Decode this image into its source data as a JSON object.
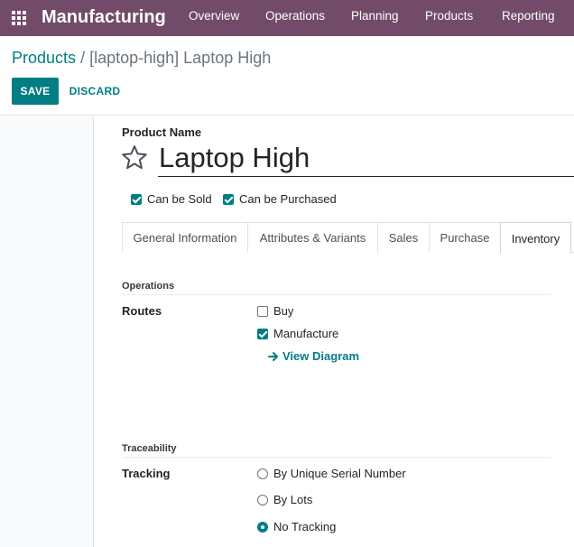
{
  "navbar": {
    "brand": "Manufacturing",
    "menu": [
      "Overview",
      "Operations",
      "Planning",
      "Products",
      "Reporting"
    ],
    "background": "#714B67"
  },
  "breadcrumb": {
    "parent": "Products",
    "separator": "/",
    "current": "[laptop-high] Laptop High"
  },
  "buttons": {
    "save": "SAVE",
    "discard": "DISCARD"
  },
  "form": {
    "product_name_label": "Product Name",
    "product_name": "Laptop High",
    "favorite_icon": "star-outline-icon",
    "can_be_sold": {
      "label": "Can be Sold",
      "checked": true
    },
    "can_be_purchased": {
      "label": "Can be Purchased",
      "checked": true
    }
  },
  "tabs": [
    {
      "label": "General Information",
      "active": false
    },
    {
      "label": "Attributes & Variants",
      "active": false
    },
    {
      "label": "Sales",
      "active": false
    },
    {
      "label": "Purchase",
      "active": false
    },
    {
      "label": "Inventory",
      "active": true
    }
  ],
  "inventory": {
    "operations_title": "Operations",
    "routes_label": "Routes",
    "routes": [
      {
        "label": "Buy",
        "checked": false
      },
      {
        "label": "Manufacture",
        "checked": true
      }
    ],
    "view_diagram": "View Diagram",
    "traceability_title": "Traceability",
    "tracking_label": "Tracking",
    "tracking_options": [
      {
        "label": "By Unique Serial Number",
        "selected": false
      },
      {
        "label": "By Lots",
        "selected": false
      },
      {
        "label": "No Tracking",
        "selected": true
      }
    ]
  },
  "colors": {
    "primary": "#017e84",
    "navbar": "#714B67"
  }
}
